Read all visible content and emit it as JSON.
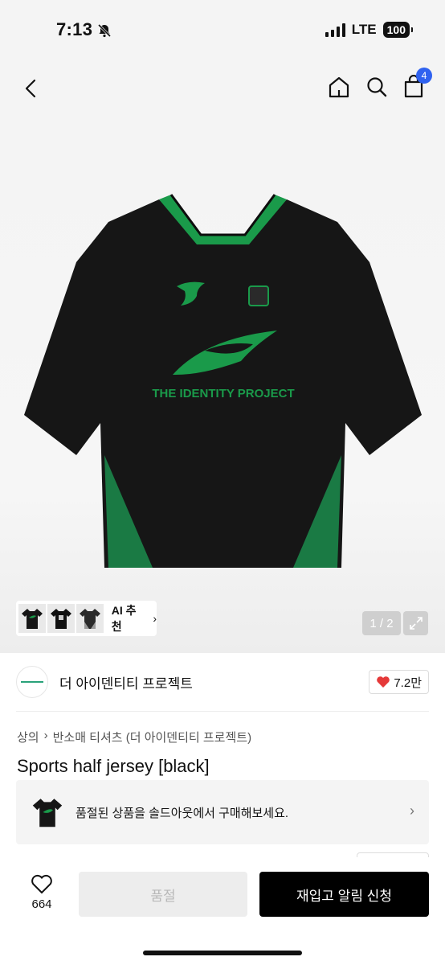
{
  "status_bar": {
    "time": "7:13",
    "network": "LTE",
    "battery": "100"
  },
  "header": {
    "cart_count": "4"
  },
  "gallery": {
    "ai_label": "AI 추천",
    "ai_chevron": "›",
    "page_indicator": "1 / 2"
  },
  "brand": {
    "name": "더 아이덴티티 프로젝트",
    "likes": "7.2만"
  },
  "breadcrumb": {
    "category": "상의",
    "separator": "›",
    "subcategory": "반소매 티셔츠 (더 아이덴티티 프로젝트)"
  },
  "product": {
    "title": "Sports half jersey [black]"
  },
  "soldout_banner": {
    "text": "품절된 상품을 솔드아웃에서 구매해보세요.",
    "chevron": "›"
  },
  "bottom_bar": {
    "wish_count": "664",
    "soldout_label": "품절",
    "restock_label": "재입고 알림 신청"
  },
  "colors": {
    "accent_green": "#1a9a4a",
    "jersey_black": "#161616",
    "cart_badge": "#2f62f0",
    "heart": "#e53939"
  },
  "icons": [
    "back-icon",
    "home-icon",
    "search-icon",
    "shopping-bag-icon",
    "bell-mute-icon",
    "expand-icon",
    "heart-icon",
    "chevron-right-icon"
  ]
}
